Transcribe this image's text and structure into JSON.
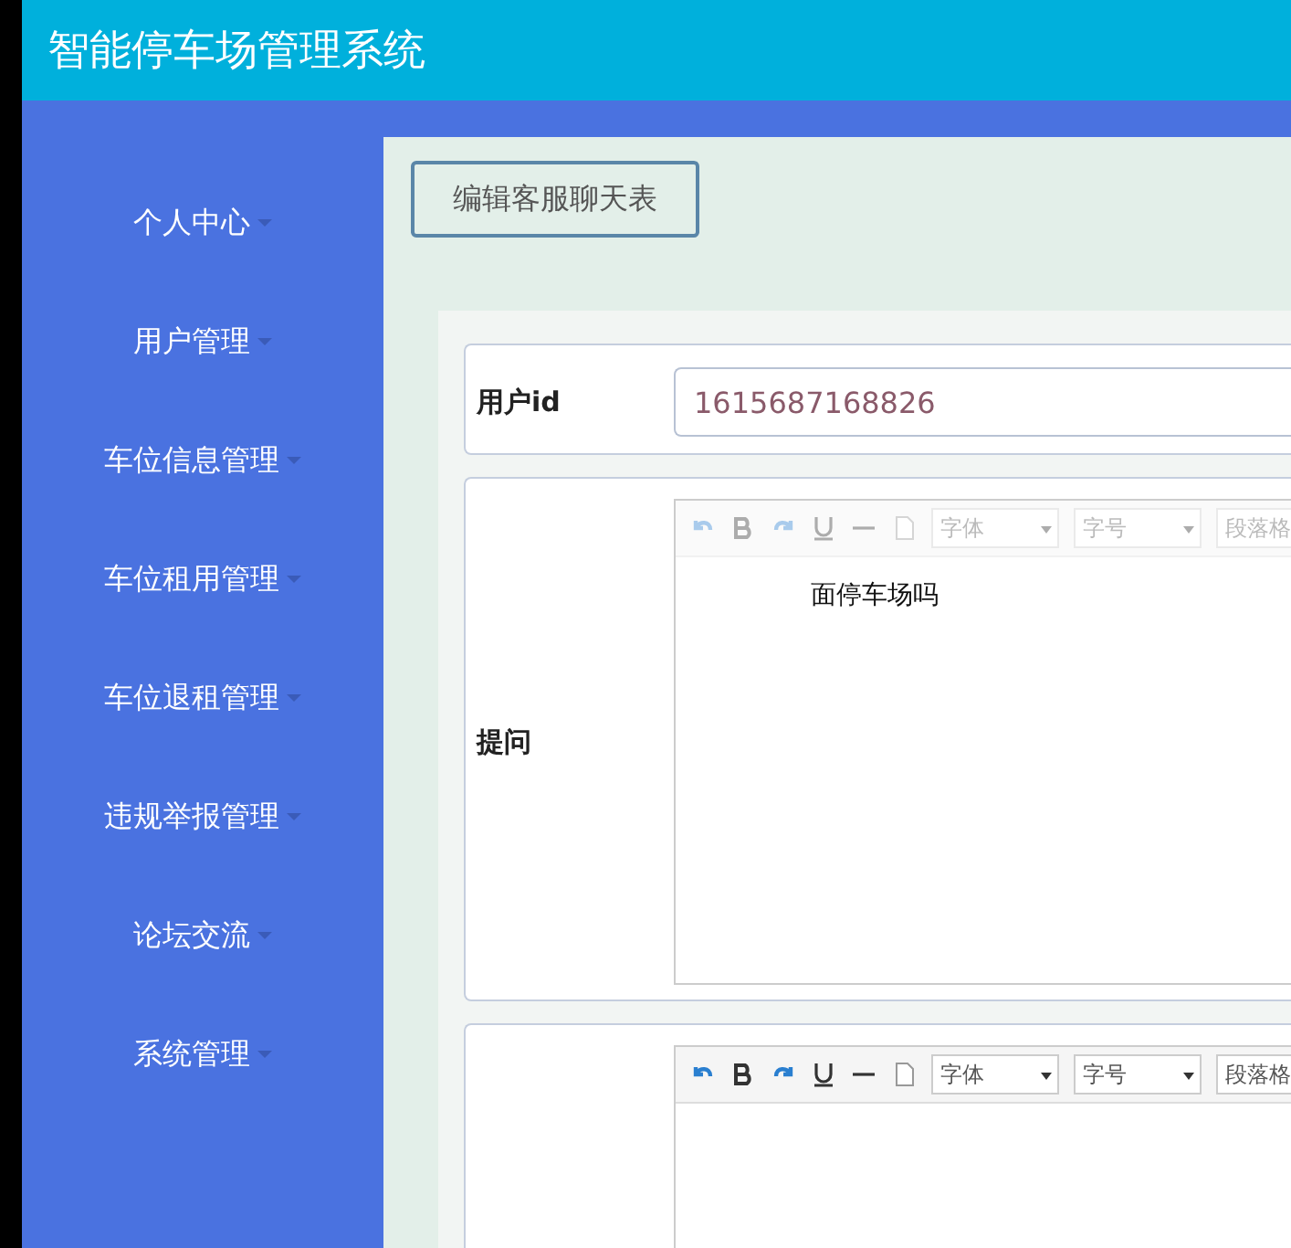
{
  "header": {
    "title": "智能停车场管理系统"
  },
  "sidebar": {
    "items": [
      {
        "label": "个人中心"
      },
      {
        "label": "用户管理"
      },
      {
        "label": "车位信息管理"
      },
      {
        "label": "车位租用管理"
      },
      {
        "label": "车位退租管理"
      },
      {
        "label": "违规举报管理"
      },
      {
        "label": "论坛交流"
      },
      {
        "label": "系统管理"
      }
    ]
  },
  "page_button": "编辑客服聊天表",
  "form": {
    "rows": [
      {
        "kind": "input",
        "label": "用户id",
        "value": "1615687168826"
      },
      {
        "kind": "editor",
        "label": "提问",
        "disabled": true,
        "toolbar": {
          "font": "字体",
          "size": "字号",
          "paragraph": "段落格"
        },
        "content": "面停车场吗"
      },
      {
        "kind": "editor",
        "label": "",
        "disabled": false,
        "toolbar": {
          "font": "字体",
          "size": "字号",
          "paragraph": "段落格"
        },
        "content": ""
      }
    ]
  }
}
